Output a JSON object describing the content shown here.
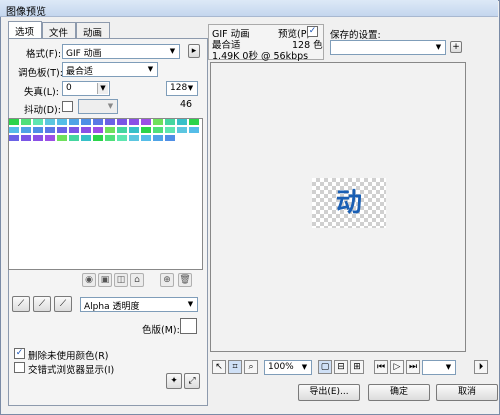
{
  "window": {
    "title": "图像预览"
  },
  "tabs": [
    {
      "label": "选项"
    },
    {
      "label": "文件"
    },
    {
      "label": "动画"
    }
  ],
  "options": {
    "format_label": "格式(F):",
    "format_value": "GIF 动画",
    "palette_label": "调色板(T):",
    "palette_value": "最合适",
    "loss_label": "失真(L):",
    "loss_value": "0",
    "colors_value": "128",
    "color_count": "46",
    "dither_label": "抖动(D):",
    "transparency_value": "Alpha 透明度",
    "matte_label": "色版(M):",
    "remove_unused_label": "删除未使用颜色(R)",
    "interlace_label": "交错式浏览器显示(I)"
  },
  "palette_colors": [
    "#2bd44a",
    "#4fe07a",
    "#5ee6b0",
    "#5cc6e0",
    "#55bde8",
    "#4fa3e6",
    "#4f8fe6",
    "#5a78e6",
    "#6a62e6",
    "#7a56e6",
    "#8a50e6",
    "#9c4fe6",
    "#6fe05c",
    "#44d6a0",
    "#36c0c8"
  ],
  "preview": {
    "format": "GIF 动画",
    "palette": "最合适",
    "stats": "1.49K  0秒 @ 56kbps",
    "preview_label": "预览(P)",
    "color_count": "128 色",
    "glyph": "动"
  },
  "saved_settings": {
    "label": "保存的设置:"
  },
  "toolbar": {
    "zoom_value": "100%"
  },
  "footer": {
    "export_label": "导出(E)...",
    "ok_label": "确定",
    "cancel_label": "取消"
  },
  "colors": {
    "accent": "#1a5fb4",
    "border": "#8d9aad"
  }
}
